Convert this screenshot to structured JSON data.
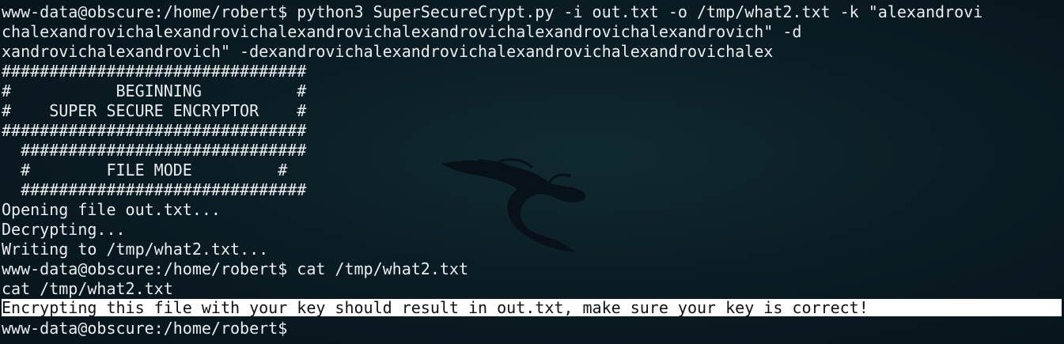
{
  "terminal": {
    "lines": [
      "www-data@obscure:/home/robert$ python3 SuperSecureCrypt.py -i out.txt -o /tmp/what2.txt -k \"alexandrovi",
      "chalexandrovichalexandrovichalexandrovichalexandrovichalexandrovichalexandrovich\" -d",
      "xandrovichalexandrovich\" -dexandrovichalexandrovichalexandrovichalexandrovichalex",
      "################################",
      "#           BEGINNING          #",
      "#    SUPER SECURE ENCRYPTOR    #",
      "################################",
      "  ##############################",
      "  #        FILE MODE         #",
      "  ##############################",
      "Opening file out.txt...",
      "Decrypting...",
      "Writing to /tmp/what2.txt...",
      "www-data@obscure:/home/robert$ cat /tmp/what2.txt",
      "cat /tmp/what2.txt",
      "Encrypting this file with your key should result in out.txt, make sure your key is correct!",
      "www-data@obscure:/home/robert$ "
    ]
  },
  "background": {
    "logo": "kali-dragon-icon"
  }
}
